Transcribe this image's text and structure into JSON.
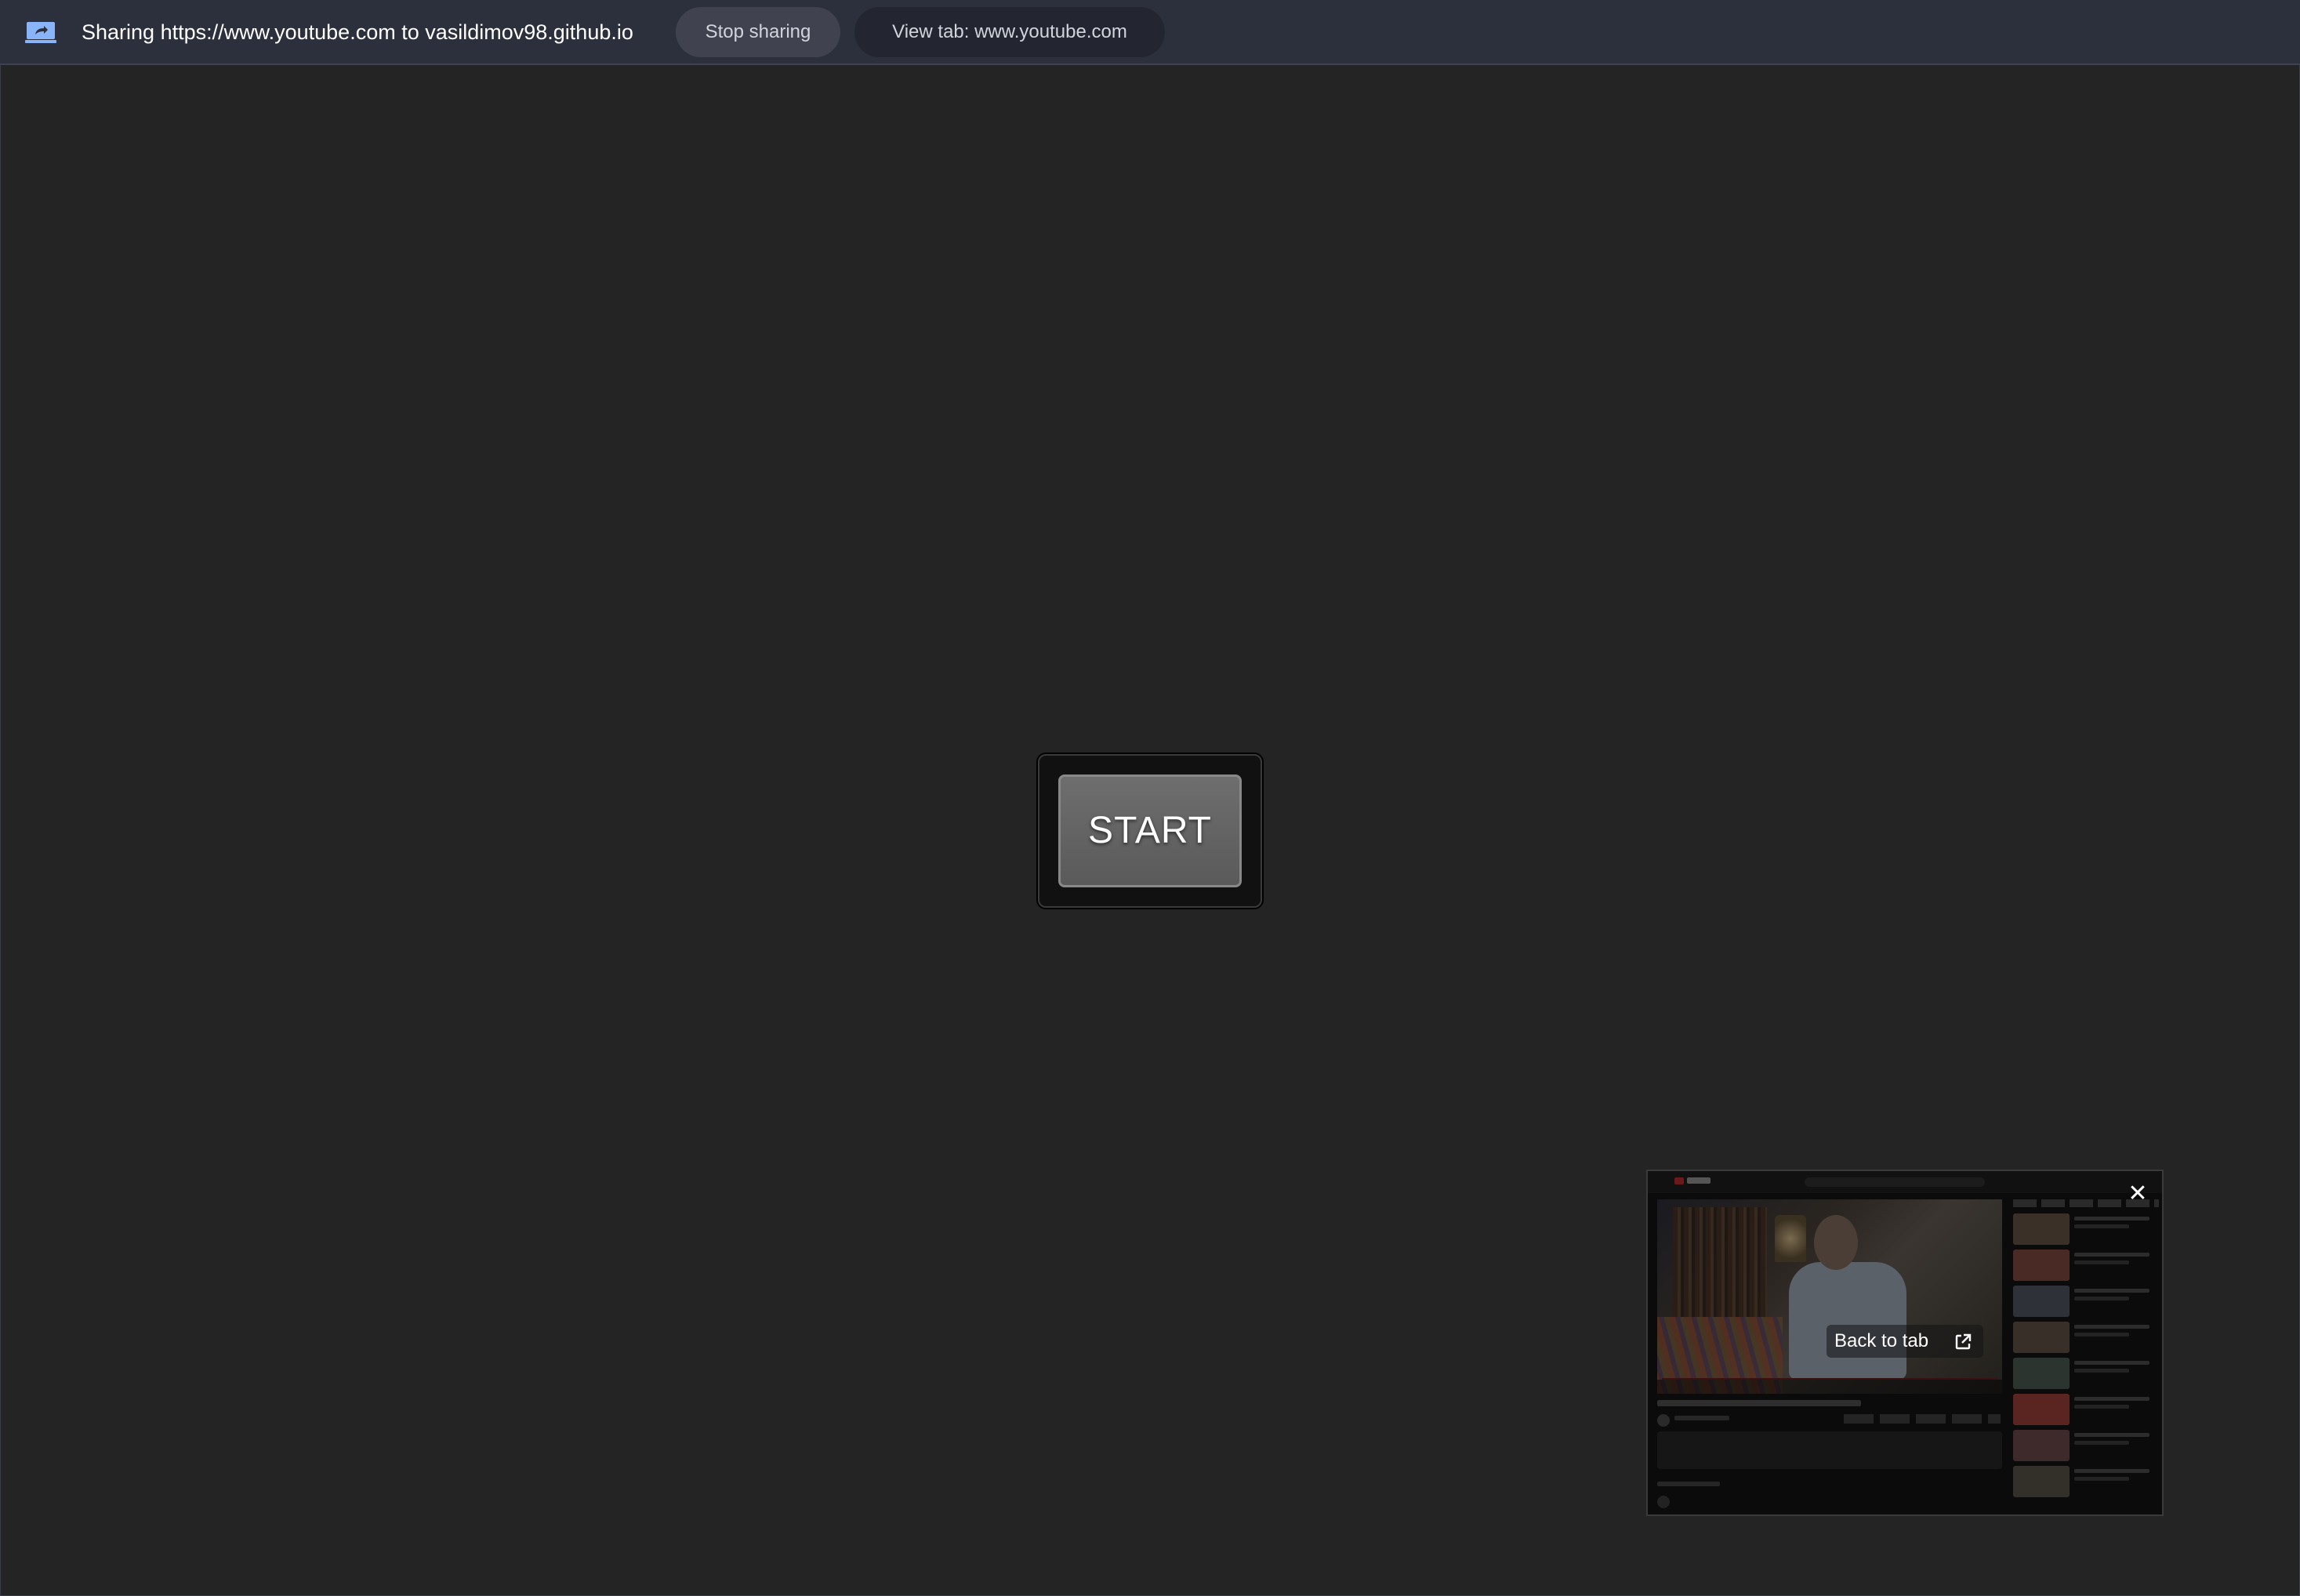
{
  "share_bar": {
    "message": "Sharing https://www.youtube.com to vasildimov98.github.io",
    "stop_label": "Stop sharing",
    "view_tab_label": "View tab: www.youtube.com",
    "icon": "screen-share-icon",
    "accent_color": "#8ab4f8"
  },
  "main": {
    "start_label": "START"
  },
  "preview": {
    "back_to_tab_label": "Back to tab",
    "close_icon": "close-icon",
    "external_icon": "open-in-new-icon"
  }
}
